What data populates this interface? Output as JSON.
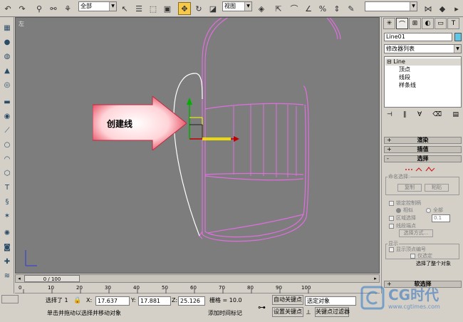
{
  "toolbar": {
    "selection_filter": "全部",
    "ref_coord_system": "视图"
  },
  "viewport": {
    "label": "左",
    "callout_text": "创建线"
  },
  "time_slider": {
    "frame_label": "0 / 100"
  },
  "ruler": {
    "ticks": [
      "0",
      "10",
      "20",
      "30",
      "40",
      "50",
      "60",
      "70",
      "80",
      "90",
      "100"
    ]
  },
  "status": {
    "selected_count": "选择了 1",
    "x_label": "X:",
    "x_value": "17.637",
    "y_label": "Y:",
    "y_value": "17.881",
    "z_label": "Z:",
    "z_value": "25.126",
    "grid": "栅格 = 10.0",
    "prompt": "单击并拖动以选择并移动对象",
    "add_time_tag": "添加时间标记",
    "auto_key": "自动关键点",
    "set_key": "设置关键点",
    "key_filter_select": "选定对象",
    "key_filters": "关键点过滤器"
  },
  "command_panel": {
    "object_name": "Line01",
    "object_color": "#5ec6e8",
    "modifier_list": "修改器列表",
    "stack": {
      "root": "Line",
      "items": [
        "顶点",
        "线段",
        "样条线"
      ]
    },
    "rollouts": {
      "render": "渲染",
      "interpolation": "插值",
      "selection": "选择",
      "soft_selection": "软选择"
    },
    "named_selections": {
      "title": "命名选择:",
      "copy": "复制",
      "paste": "粘贴"
    },
    "lock_handles": "锁定控制柄",
    "lock_similar": "相似",
    "lock_all": "全部",
    "area_selection": "区域选择",
    "area_value": "0.1",
    "segment_end": "线段端点",
    "select_by": "选择方式...",
    "display": {
      "title": "显示",
      "show_vertex_numbers": "显示顶点编号",
      "selected_only": "仅选定"
    },
    "selection_info": "选择了整个对象"
  },
  "watermark": {
    "brand": "CG时代",
    "site": "www.cgtimes.com"
  }
}
